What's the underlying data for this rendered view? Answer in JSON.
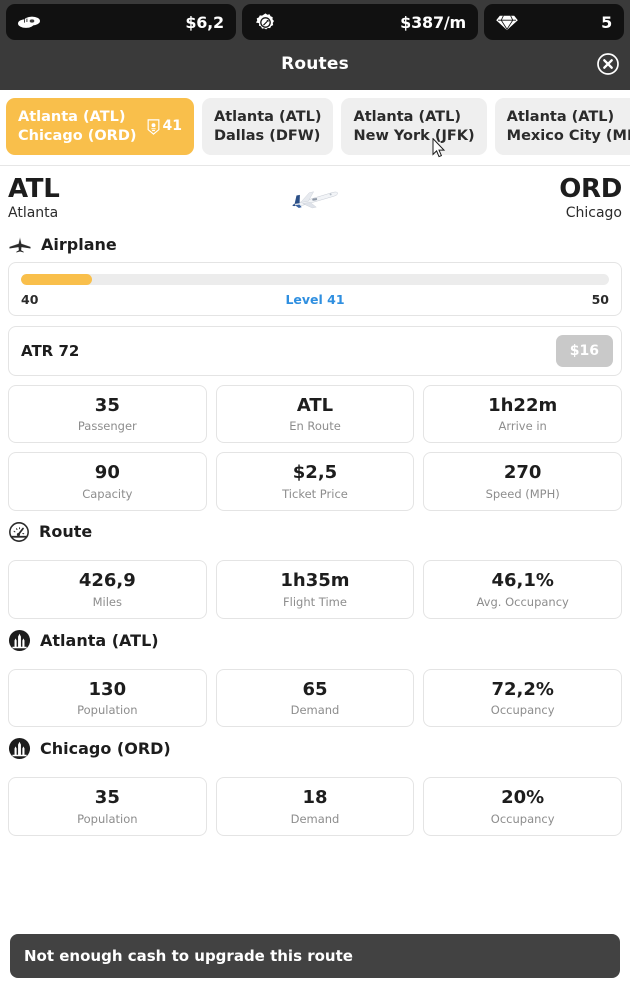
{
  "resources": [
    {
      "id": "cash",
      "icon": "money-stack-icon",
      "value": "$6,2"
    },
    {
      "id": "income",
      "icon": "gear-income-icon",
      "value": "$387/m"
    },
    {
      "id": "gems",
      "icon": "diamond-icon",
      "value": "5"
    }
  ],
  "header": {
    "title": "Routes",
    "close_icon": "close-circle-icon"
  },
  "tabs": [
    {
      "origin": "Atlanta (ATL)",
      "destination": "Chicago (ORD)",
      "active": true,
      "badge_icon": "rank-shield-icon",
      "badge": "41"
    },
    {
      "origin": "Atlanta (ATL)",
      "destination": "Dallas (DFW)",
      "active": false,
      "badge": ""
    },
    {
      "origin": "Atlanta (ATL)",
      "destination": "New York (JFK)",
      "active": false,
      "badge": ""
    },
    {
      "origin": "Atlanta (ATL)",
      "destination": "Mexico City (MEX)",
      "active": false,
      "badge": ""
    }
  ],
  "route_header": {
    "origin_code": "ATL",
    "origin_city": "Atlanta",
    "destination_code": "ORD",
    "destination_city": "Chicago",
    "plane_art": "airliner-image"
  },
  "airplane_section": {
    "icon": "airplane-top-icon",
    "title": "Airplane",
    "progress": {
      "min_label": "40",
      "max_label": "50",
      "level_label": "Level 41",
      "percent": 12
    },
    "aircraft_name": "ATR 72",
    "upgrade_price": "$16",
    "upgrade_disabled": true,
    "stats": [
      {
        "value": "35",
        "label": "Passenger"
      },
      {
        "value": "ATL",
        "label": "En Route"
      },
      {
        "value": "1h22m",
        "label": "Arrive in"
      },
      {
        "value": "90",
        "label": "Capacity"
      },
      {
        "value": "$2,5",
        "label": "Ticket Price"
      },
      {
        "value": "270",
        "label": "Speed (MPH)"
      }
    ]
  },
  "route_section": {
    "icon": "speedometer-icon",
    "title": "Route",
    "stats": [
      {
        "value": "426,9",
        "label": "Miles"
      },
      {
        "value": "1h35m",
        "label": "Flight Time"
      },
      {
        "value": "46,1%",
        "label": "Avg. Occupancy"
      }
    ]
  },
  "origin_section": {
    "icon": "city-skyline-icon",
    "title": "Atlanta (ATL)",
    "stats": [
      {
        "value": "130",
        "label": "Population"
      },
      {
        "value": "65",
        "label": "Demand"
      },
      {
        "value": "72,2%",
        "label": "Occupancy"
      }
    ]
  },
  "destination_section": {
    "icon": "city-skyline-icon",
    "title": "Chicago (ORD)",
    "stats": [
      {
        "value": "35",
        "label": "Population"
      },
      {
        "value": "18",
        "label": "Demand"
      },
      {
        "value": "20%",
        "label": "Occupancy"
      }
    ]
  },
  "toast": {
    "message": "Not enough cash to upgrade this route"
  },
  "colors": {
    "accent": "#f9bf4b",
    "dark_bar": "#3a3a3a",
    "chip_bg": "#111111",
    "level_blue": "#2f8fe0",
    "toast_bg": "#424242",
    "disabled_btn": "#c9c9c9"
  }
}
